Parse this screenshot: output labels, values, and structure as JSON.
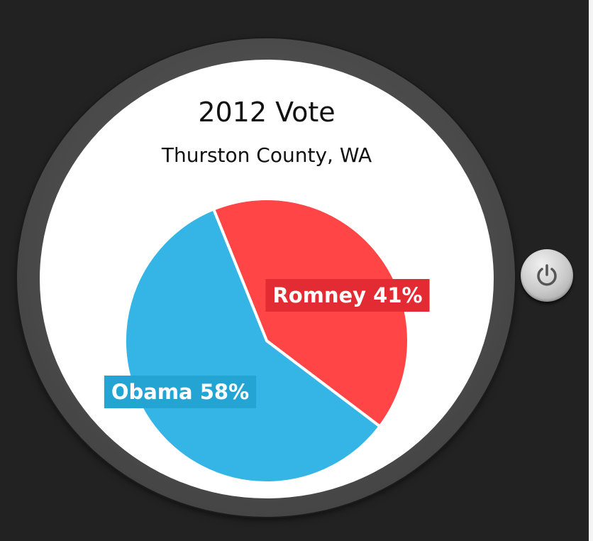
{
  "chart_data": {
    "type": "pie",
    "title": "2012 Vote",
    "subtitle": "Thurston County, WA",
    "slices": [
      {
        "name": "Romney",
        "label": "Romney 41%",
        "value": 41,
        "color": "#ff4545",
        "label_bg": "#e32b33"
      },
      {
        "name": "Obama",
        "label": "Obama 58%",
        "value": 58,
        "color": "#35b5e5",
        "label_bg": "#24a4d3"
      }
    ],
    "start_angle_deg": -22,
    "separator_color": "#ffffff"
  },
  "icons": {
    "power": "power-icon"
  }
}
